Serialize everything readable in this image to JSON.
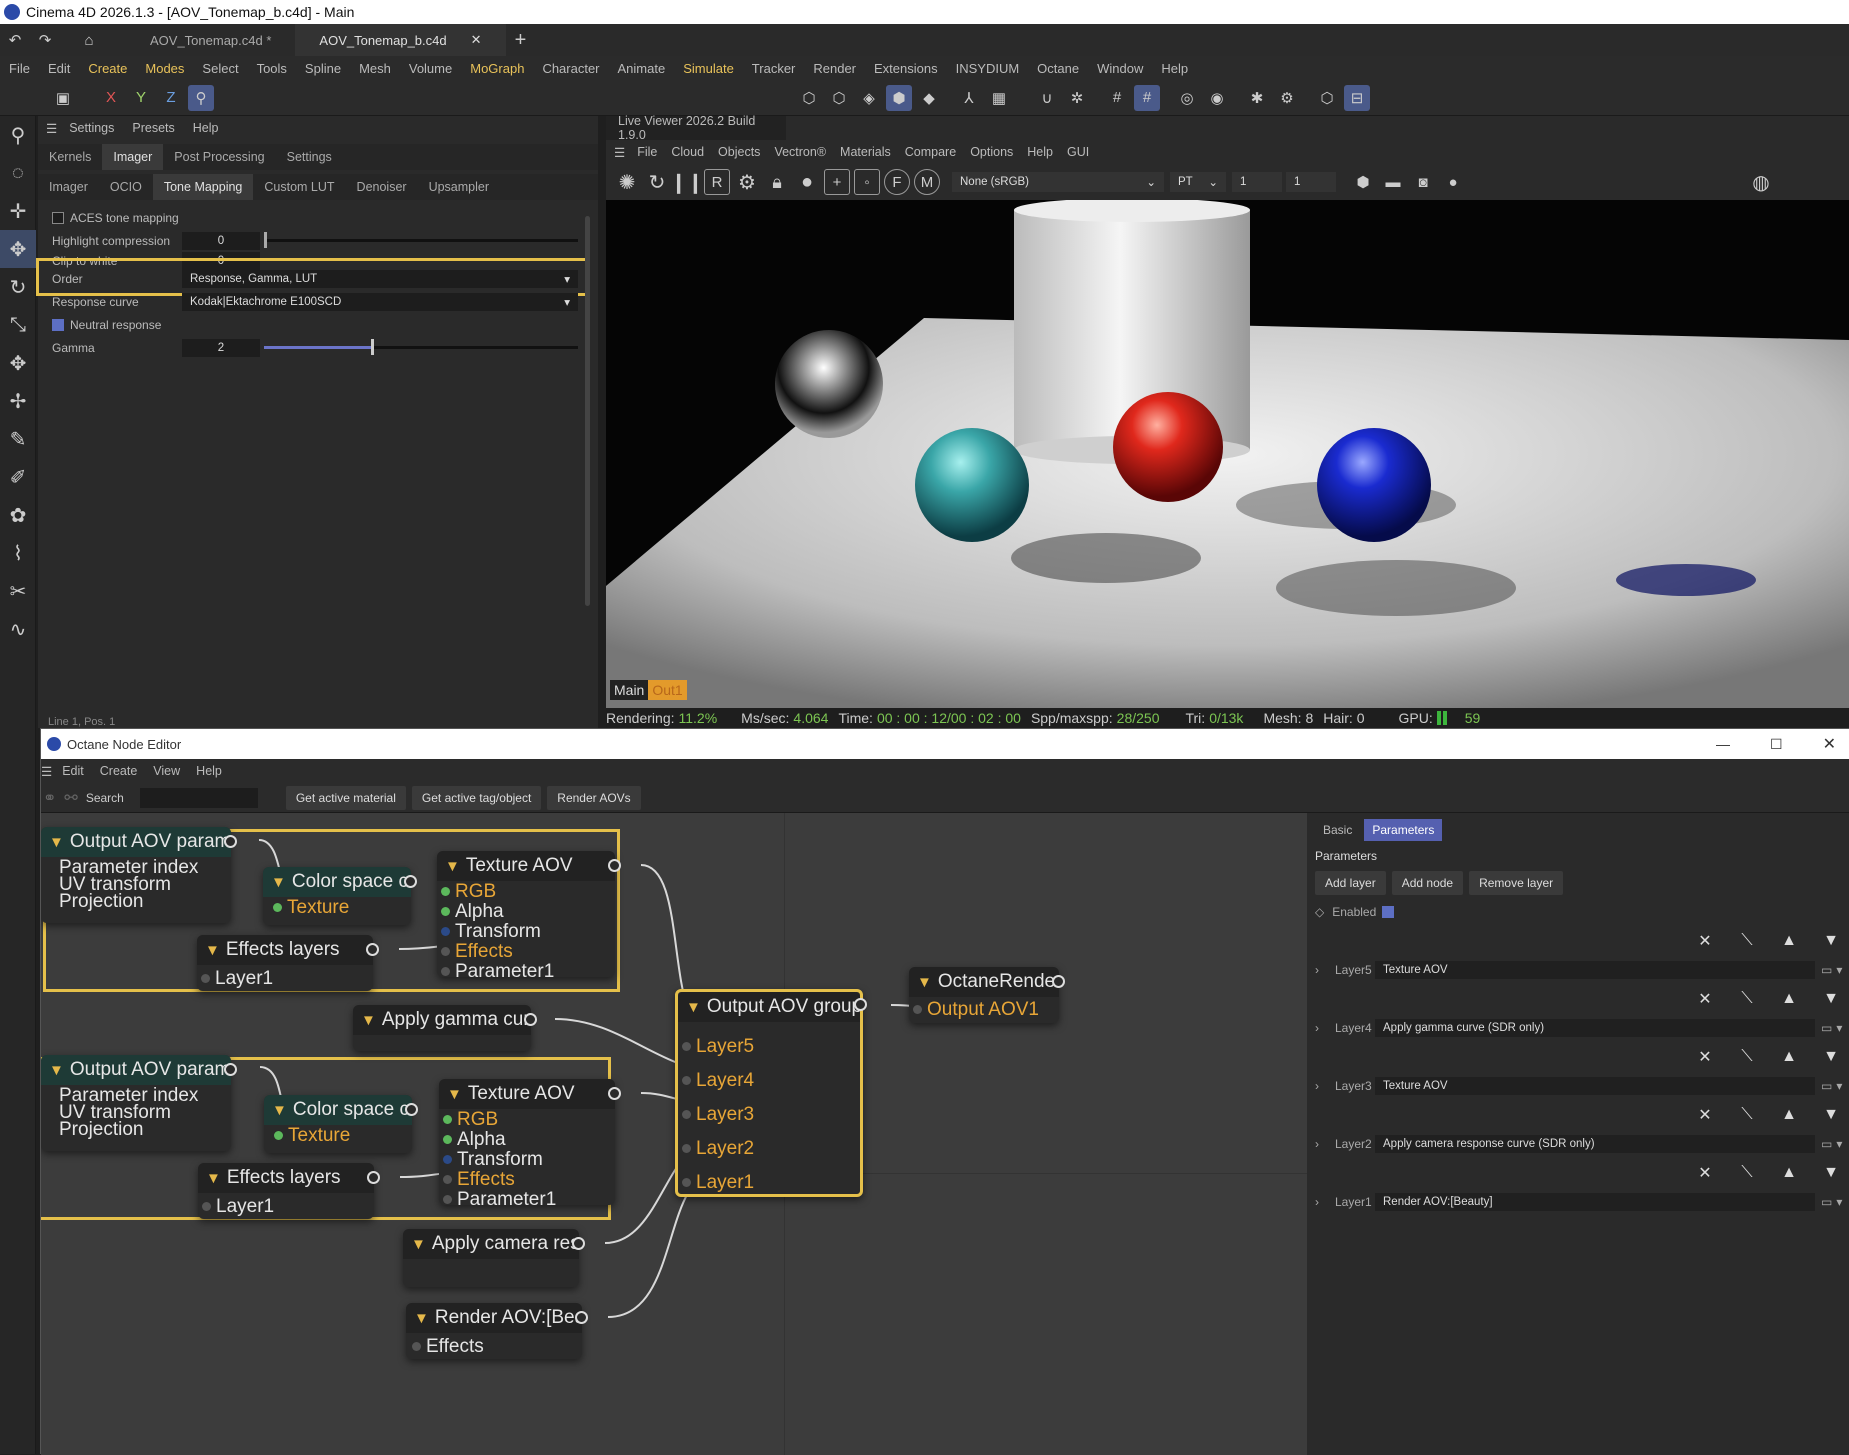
{
  "window": {
    "title": "Cinema 4D 2026.1.3 - [AOV_Tonemap_b.c4d] - Main"
  },
  "doc_tabs": [
    {
      "label": "AOV_Tonemap.c4d *"
    },
    {
      "label": "AOV_Tonemap_b.c4d"
    }
  ],
  "menu": [
    "File",
    "Edit",
    "Create",
    "Modes",
    "Select",
    "Tools",
    "Spline",
    "Mesh",
    "Volume",
    "MoGraph",
    "Character",
    "Animate",
    "Simulate",
    "Tracker",
    "Render",
    "Extensions",
    "INSYDIUM",
    "Octane",
    "Window",
    "Help"
  ],
  "toolbar": {
    "x": "X",
    "y": "Y",
    "z": "Z"
  },
  "attr": {
    "menu": [
      "Settings",
      "Presets",
      "Help"
    ],
    "tabs": [
      "Kernels",
      "Imager",
      "Post Processing",
      "Settings"
    ],
    "subtabs": [
      "Imager",
      "OCIO",
      "Tone Mapping",
      "Custom LUT",
      "Denoiser",
      "Upsampler"
    ],
    "aces": "ACES tone mapping",
    "highlight_label": "Highlight compression",
    "highlight_val": "0",
    "clip_label": "Clip to white",
    "clip_val": "0",
    "order_label": "Order",
    "order_val": "Response, Gamma, LUT",
    "curve_label": "Response curve",
    "curve_val": "Kodak|Ektachrome E100SCD",
    "neutral": "Neutral response",
    "gamma_label": "Gamma",
    "gamma_val": "2",
    "gamma_level": 0.34,
    "status": "Line 1, Pos. 1"
  },
  "viewer": {
    "title": "Live Viewer 2026.2 Build 1.9.0",
    "menu": [
      "File",
      "Cloud",
      "Objects",
      "Vectron®",
      "Materials",
      "Compare",
      "Options",
      "Help",
      "GUI"
    ],
    "colorspace": "None (sRGB)",
    "mode": "PT",
    "field1": "1",
    "field2": "1",
    "tag_main": "Main",
    "tag_out": "Out1",
    "status": {
      "rendering": "Rendering:",
      "rendering_val": "11.2%",
      "ms": "Ms/sec:",
      "ms_val": "4.064",
      "time": "Time:",
      "time_val": "00 : 00 : 12/00 : 02 : 00",
      "spp": "Spp/maxspp:",
      "spp_val": "28/250",
      "tri": "Tri:",
      "tri_val": "0/13k",
      "mesh": "Mesh: 8",
      "hair": "Hair: 0",
      "gpu": "GPU:",
      "gpu_val": "59"
    }
  },
  "node_editor": {
    "title": "Octane Node Editor",
    "menu": [
      "Edit",
      "Create",
      "View",
      "Help"
    ],
    "search": "Search",
    "buttons": [
      "Get active material",
      "Get active tag/object",
      "Render AOVs"
    ],
    "nodes": {
      "out_param_1": {
        "title": "Output AOV paramete",
        "lines": [
          "Parameter index",
          "UV transform",
          "Projection"
        ]
      },
      "cs_1": {
        "title": "Color space con",
        "lines": [
          "Texture"
        ]
      },
      "tex_1": {
        "title": "Texture AOV",
        "lines": [
          "RGB",
          "Alpha",
          "Transform",
          "Effects",
          "Parameter1"
        ]
      },
      "eff_1": {
        "title": "Effects layers",
        "lines": [
          "Layer1"
        ]
      },
      "gamma": {
        "title": "Apply gamma curv"
      },
      "out_param_2": {
        "title": "Output AOV paramete",
        "lines": [
          "Parameter index",
          "UV transform",
          "Projection"
        ]
      },
      "cs_2": {
        "title": "Color space con",
        "lines": [
          "Texture"
        ]
      },
      "tex_2": {
        "title": "Texture AOV",
        "lines": [
          "RGB",
          "Alpha",
          "Transform",
          "Effects",
          "Parameter1"
        ]
      },
      "eff_2": {
        "title": "Effects layers",
        "lines": [
          "Layer1"
        ]
      },
      "camresp": {
        "title": "Apply camera resp"
      },
      "renderaov": {
        "title": "Render AOV:[Beaut",
        "lines": [
          "Effects"
        ]
      },
      "group": {
        "title": "Output AOV group",
        "lines": [
          "Layer5",
          "Layer4",
          "Layer3",
          "Layer2",
          "Layer1"
        ]
      },
      "octane": {
        "title": "OctaneRender",
        "lines": [
          "Output AOV1"
        ]
      }
    },
    "panel": {
      "tabs": [
        "Basic",
        "Parameters"
      ],
      "heading": "Parameters",
      "buttons": [
        "Add layer",
        "Add node",
        "Remove layer"
      ],
      "enabled": "Enabled",
      "layers": [
        {
          "name": "Layer5",
          "value": "Texture AOV"
        },
        {
          "name": "Layer4",
          "value": "Apply gamma curve (SDR only)"
        },
        {
          "name": "Layer3",
          "value": "Texture AOV"
        },
        {
          "name": "Layer2",
          "value": "Apply camera response curve (SDR only)"
        },
        {
          "name": "Layer1",
          "value": "Render AOV:[Beauty]"
        }
      ]
    }
  },
  "colors": {
    "accent": "#e5c04a",
    "orange": "#e8a637",
    "selected": "#5560b0"
  }
}
